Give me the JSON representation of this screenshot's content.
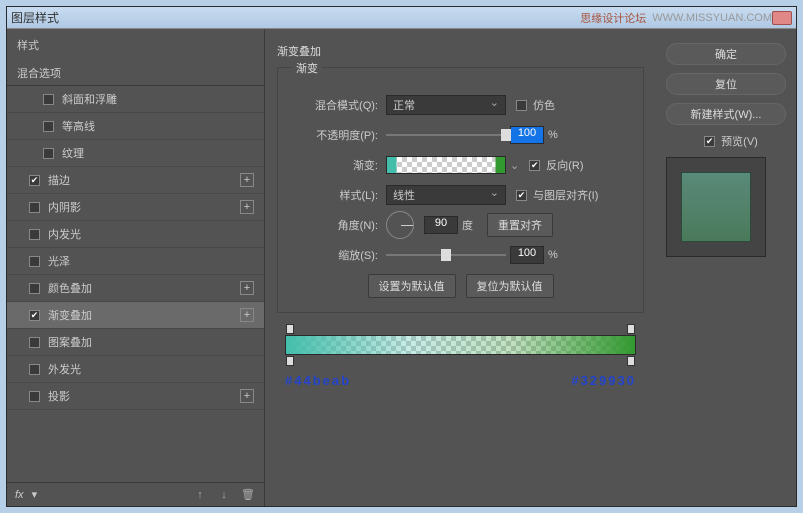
{
  "titlebar": {
    "title": "图层样式",
    "watermark1": "思缘设计论坛",
    "watermark2": "WWW.MISSYUAN.COM"
  },
  "sidebar": {
    "styles_header": "样式",
    "blend_header": "混合选项",
    "items": [
      {
        "label": "斜面和浮雕",
        "checked": false,
        "plus": false
      },
      {
        "label": "等高线",
        "checked": false,
        "plus": false
      },
      {
        "label": "纹理",
        "checked": false,
        "plus": false
      },
      {
        "label": "描边",
        "checked": true,
        "plus": true
      },
      {
        "label": "内阴影",
        "checked": false,
        "plus": true
      },
      {
        "label": "内发光",
        "checked": false,
        "plus": false
      },
      {
        "label": "光泽",
        "checked": false,
        "plus": false
      },
      {
        "label": "颜色叠加",
        "checked": false,
        "plus": true
      },
      {
        "label": "渐变叠加",
        "checked": true,
        "plus": true,
        "selected": true
      },
      {
        "label": "图案叠加",
        "checked": false,
        "plus": false
      },
      {
        "label": "外发光",
        "checked": false,
        "plus": false
      },
      {
        "label": "投影",
        "checked": false,
        "plus": true
      }
    ],
    "footer_fx": "fx"
  },
  "main": {
    "section_title": "渐变叠加",
    "fieldset_legend": "渐变",
    "blend_mode": {
      "label": "混合模式(Q):",
      "value": "正常"
    },
    "dither": {
      "label": "仿色"
    },
    "opacity": {
      "label": "不透明度(P):",
      "value": "100",
      "unit": "%"
    },
    "gradient": {
      "label": "渐变:"
    },
    "reverse": {
      "label": "反向(R)"
    },
    "style": {
      "label": "样式(L):",
      "value": "线性"
    },
    "align": {
      "label": "与图层对齐(I)"
    },
    "angle": {
      "label": "角度(N):",
      "value": "90",
      "unit": "度"
    },
    "reset_align": "重置对齐",
    "scale": {
      "label": "缩放(S):",
      "value": "100",
      "unit": "%"
    },
    "set_default": "设置为默认值",
    "reset_default": "复位为默认值",
    "hex_left": "#44beab",
    "hex_right": "#329930"
  },
  "right": {
    "ok": "确定",
    "cancel": "复位",
    "new_style": "新建样式(W)...",
    "preview": "预览(V)"
  }
}
